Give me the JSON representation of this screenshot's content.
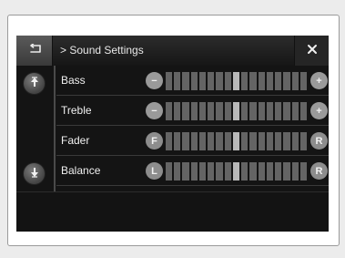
{
  "header": {
    "title": "> Sound Settings",
    "back_icon": "back-arrow-icon",
    "close_symbol": "✕"
  },
  "rows": [
    {
      "label": "Bass",
      "left_symbol": "−",
      "right_symbol": "+",
      "value": 0
    },
    {
      "label": "Treble",
      "left_symbol": "−",
      "right_symbol": "+",
      "value": 0
    },
    {
      "label": "Fader",
      "left_symbol": "F",
      "right_symbol": "R",
      "value": 0
    },
    {
      "label": "Balance",
      "left_symbol": "L",
      "right_symbol": "R",
      "value": 0
    }
  ],
  "scroll": {
    "up_icon": "scroll-up-icon",
    "down_icon": "scroll-down-icon"
  },
  "colors": {
    "background": "#1b1b1b",
    "segment": "#646464",
    "segment_center": "#b9b9b9",
    "text": "#f0f0f0"
  }
}
